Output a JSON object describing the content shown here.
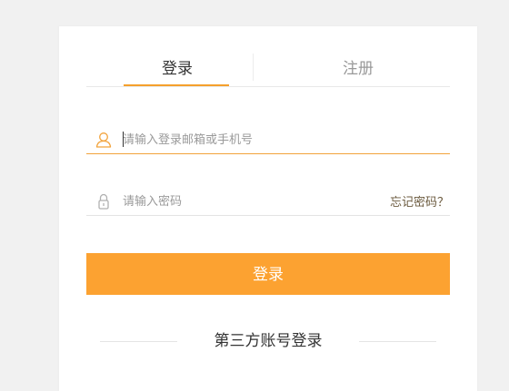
{
  "tabs": {
    "login_label": "登录",
    "register_label": "注册"
  },
  "account_field": {
    "placeholder": "请输入登录邮箱或手机号",
    "icon": "user-icon"
  },
  "password_field": {
    "placeholder": "请输入密码",
    "icon": "lock-icon"
  },
  "forgot_password_label": "忘记密码？",
  "login_button_label": "登录",
  "third_party_title": "第三方账号登录",
  "colors": {
    "accent": "#fca231",
    "active_underline": "#f5a02c",
    "page_background": "#f1f1f1"
  }
}
